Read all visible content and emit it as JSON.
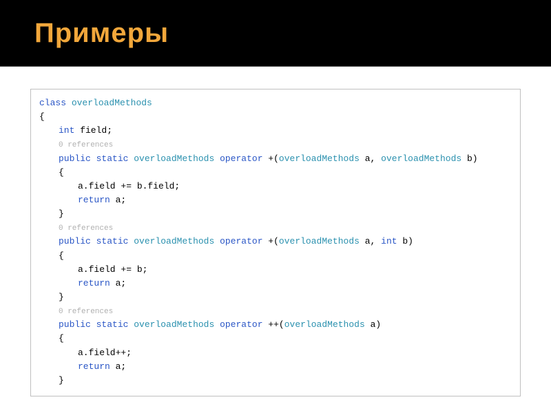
{
  "slide": {
    "title": "Примеры"
  },
  "code": {
    "kw_class": "class",
    "type": "overloadMethods",
    "brace_open": "{",
    "brace_close": "}",
    "kw_int": "int",
    "field_decl_tail": " field;",
    "ref_text": "0 references",
    "kw_public": "public",
    "kw_static": "static",
    "kw_operator": "operator",
    "kw_return": "return",
    "sig1_op": " +(",
    "sig1_a": " a, ",
    "sig1_b": " b)",
    "sig2_op": " +(",
    "sig2_a": " a, ",
    "sig2_tail": " b)",
    "sig3_op": " ++(",
    "sig3_tail": " a)",
    "body1_line1": "a.field += b.field;",
    "body_return_a": " a;",
    "body2_line1": "a.field += b;",
    "body3_line1": "a.field++;",
    "space": " "
  }
}
